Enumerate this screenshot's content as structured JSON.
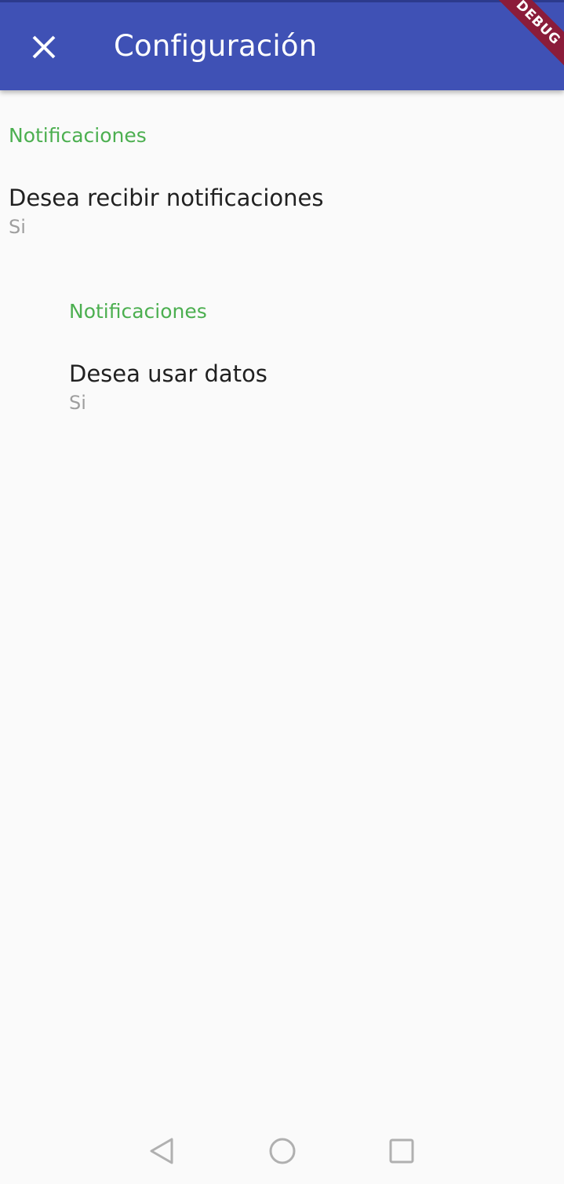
{
  "app_bar": {
    "title": "Configuración",
    "background_color": "#3f51b5",
    "close_icon": "close-icon"
  },
  "debug_banner": {
    "label": "DEBUG",
    "color": "#8b1c3a"
  },
  "sections": [
    {
      "title": "Notificaciones",
      "title_color": "#4caf50",
      "tile": {
        "title": "Desea recibir notificaciones",
        "subtitle": "Si"
      }
    },
    {
      "title": "Notificaciones",
      "title_color": "#4caf50",
      "tile": {
        "title": "Desea usar datos",
        "subtitle": "Si"
      }
    }
  ],
  "navigation_bar": {
    "buttons": [
      "back-icon",
      "home-icon",
      "recents-icon"
    ]
  }
}
